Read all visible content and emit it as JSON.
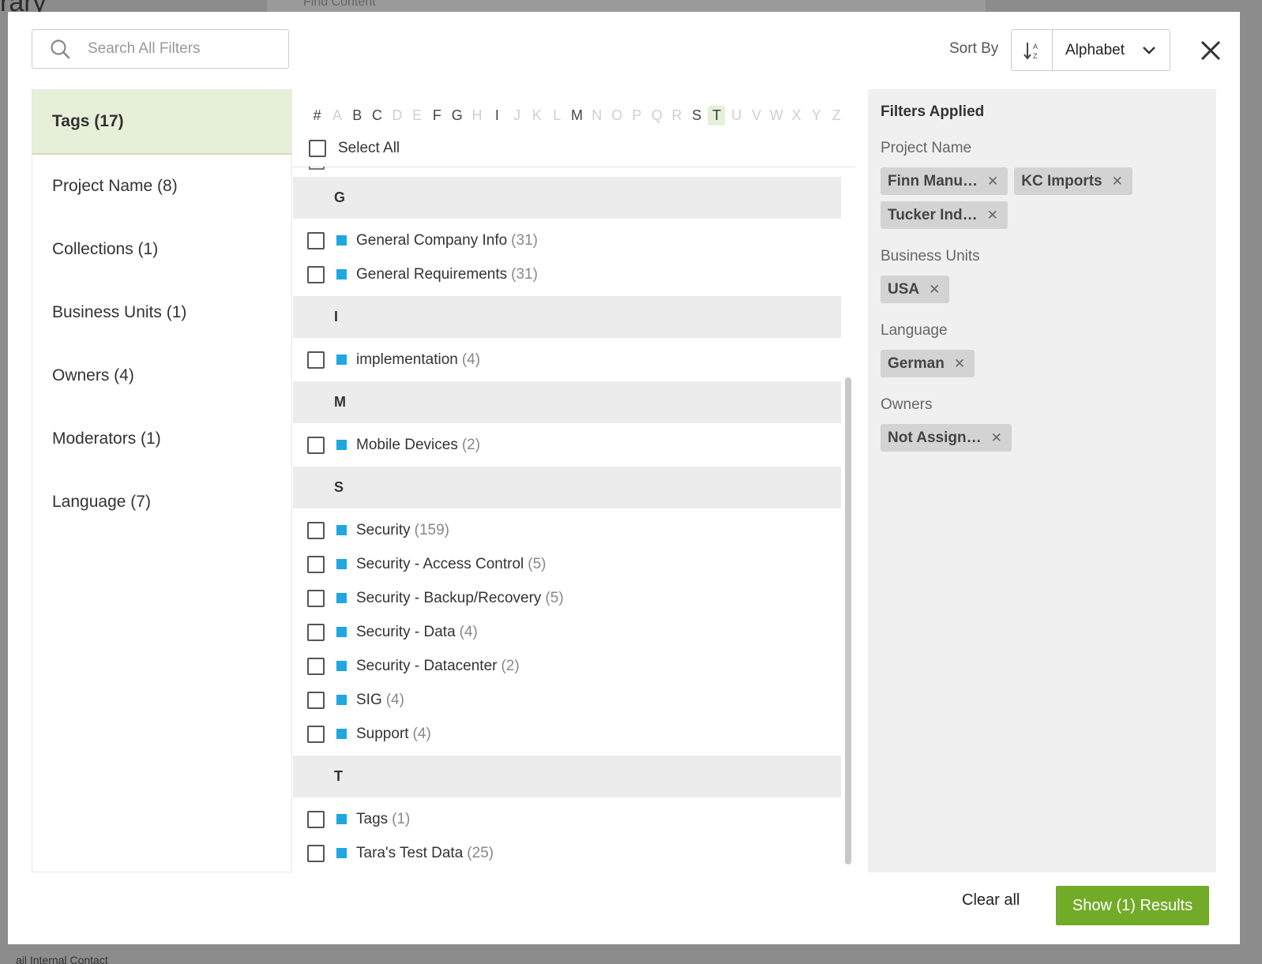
{
  "background": {
    "title": "rary",
    "search_placeholder": "Find Content",
    "bottom_text": "ail Internal Contact"
  },
  "search": {
    "placeholder": "Search All Filters"
  },
  "sort": {
    "label": "Sort By",
    "value": "Alphabet"
  },
  "categories": [
    {
      "label": "Tags (17)",
      "active": true
    },
    {
      "label": "Project Name (8)"
    },
    {
      "label": "Collections (1)"
    },
    {
      "label": "Business Units (1)"
    },
    {
      "label": "Owners (4)"
    },
    {
      "label": "Moderators (1)"
    },
    {
      "label": "Language (7)"
    }
  ],
  "alphabet": [
    "#",
    "A",
    "B",
    "C",
    "D",
    "E",
    "F",
    "G",
    "H",
    "I",
    "J",
    "K",
    "L",
    "M",
    "N",
    "O",
    "P",
    "Q",
    "R",
    "S",
    "T",
    "U",
    "V",
    "W",
    "X",
    "Y",
    "Z"
  ],
  "alphabet_enabled": [
    "#",
    "B",
    "C",
    "F",
    "G",
    "I",
    "M",
    "S",
    "T"
  ],
  "alphabet_selected": "T",
  "select_all_label": "Select All",
  "groups": [
    {
      "letter": "G",
      "items": [
        {
          "label": "General Company Info",
          "count": "(31)"
        },
        {
          "label": "General Requirements",
          "count": "(31)"
        }
      ]
    },
    {
      "letter": "I",
      "items": [
        {
          "label": "implementation",
          "count": "(4)"
        }
      ]
    },
    {
      "letter": "M",
      "items": [
        {
          "label": "Mobile Devices",
          "count": "(2)"
        }
      ]
    },
    {
      "letter": "S",
      "items": [
        {
          "label": "Security",
          "count": "(159)"
        },
        {
          "label": "Security - Access Control",
          "count": "(5)"
        },
        {
          "label": "Security - Backup/Recovery",
          "count": "(5)"
        },
        {
          "label": "Security - Data",
          "count": "(4)"
        },
        {
          "label": "Security - Datacenter",
          "count": "(2)"
        },
        {
          "label": "SIG",
          "count": "(4)"
        },
        {
          "label": "Support",
          "count": "(4)"
        }
      ]
    },
    {
      "letter": "T",
      "items": [
        {
          "label": "Tags",
          "count": "(1)"
        },
        {
          "label": "Tara's Test Data",
          "count": "(25)"
        }
      ]
    }
  ],
  "tag_color": "#1ea7e1",
  "applied": {
    "title": "Filters Applied",
    "groups": [
      {
        "label": "Project Name",
        "chips": [
          "Finn Manu…",
          "KC Imports",
          "Tucker Ind…"
        ]
      },
      {
        "label": "Business Units",
        "chips": [
          "USA"
        ]
      },
      {
        "label": "Language",
        "chips": [
          "German"
        ]
      },
      {
        "label": "Owners",
        "chips": [
          "Not Assign…"
        ]
      }
    ]
  },
  "footer": {
    "clear_label": "Clear all",
    "show_label": "Show (1) Results"
  },
  "colors": {
    "accent_green": "#72ab28",
    "active_bg": "#e6f0d8"
  }
}
